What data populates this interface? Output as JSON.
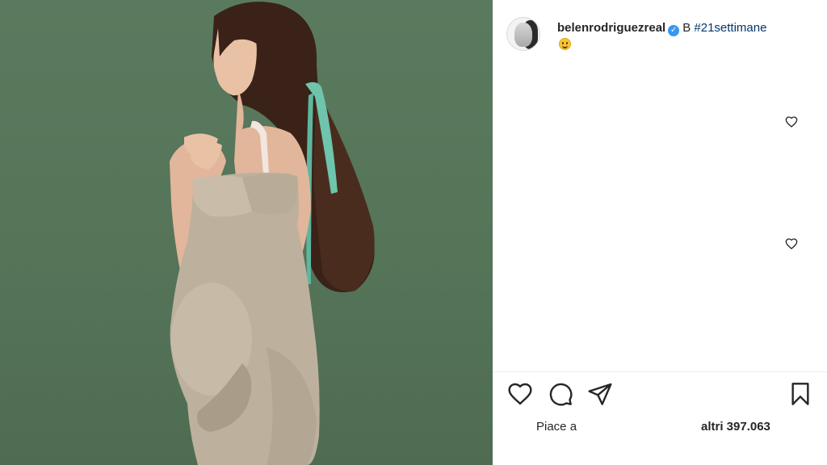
{
  "post": {
    "username": "belenrodriguezreal",
    "verified_icon": "verified-badge-icon",
    "caption_prefix": "B",
    "hashtag": "#21settimane",
    "emoji": "smiling-face-emoji"
  },
  "comments": [
    {
      "like_icon": "heart-outline-icon"
    },
    {
      "like_icon": "heart-outline-icon"
    }
  ],
  "actions": {
    "like_icon": "heart-outline-icon",
    "comment_icon": "speech-bubble-icon",
    "share_icon": "paper-plane-icon",
    "save_icon": "bookmark-icon"
  },
  "likes": {
    "label": "Piace a",
    "count_text": "altri 397.063"
  },
  "colors": {
    "background_green": "#567558",
    "dress": "#bdb19e",
    "ribbon": "#6fc4ac",
    "verified": "#3897f0",
    "hashtag": "#00376b"
  }
}
